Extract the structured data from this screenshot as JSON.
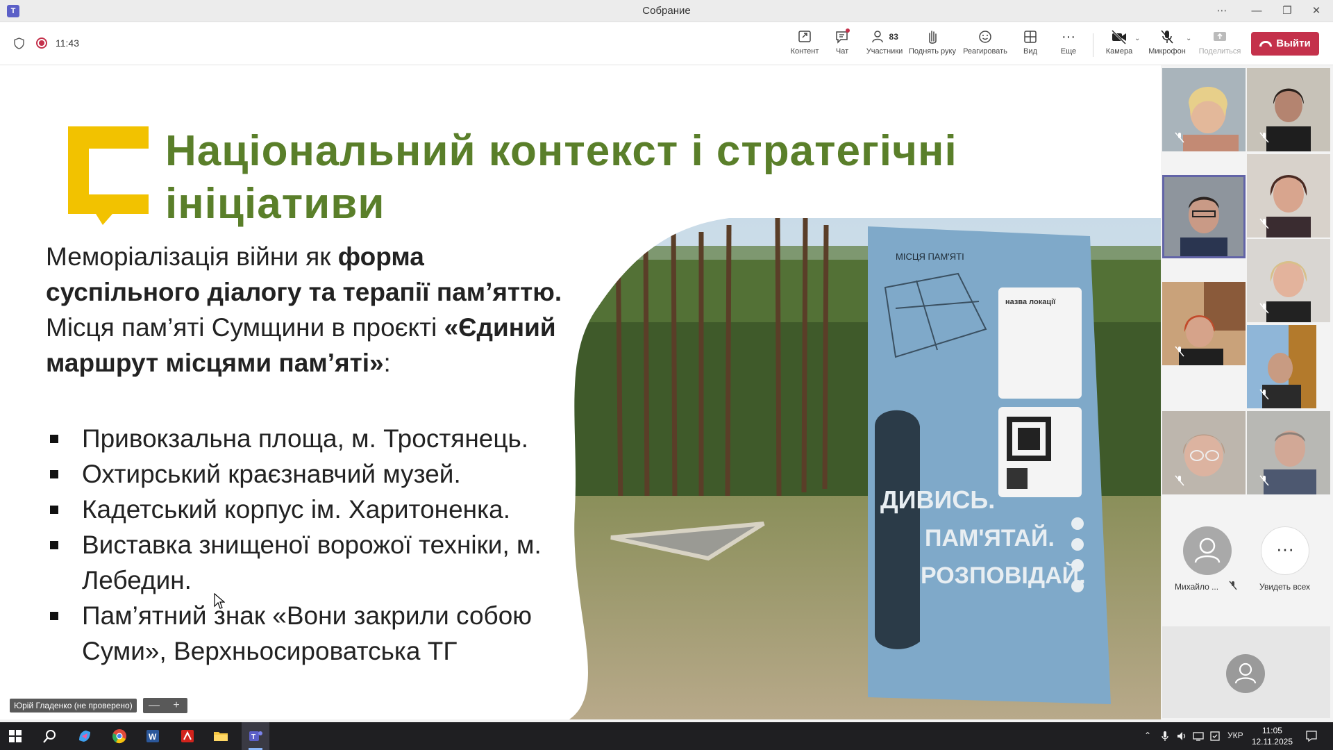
{
  "window": {
    "title": "Собрание"
  },
  "toolbar": {
    "timer": "11:43",
    "content": "Контент",
    "chat": "Чат",
    "participants_count": "83",
    "participants": "Участники",
    "raise_hand": "Поднять руку",
    "react": "Реагировать",
    "view": "Вид",
    "more": "Еще",
    "camera": "Камера",
    "microphone": "Микрофон",
    "share": "Поделиться",
    "leave": "Выйти"
  },
  "slide": {
    "title_line1": "Національний контекст і стратегічні",
    "title_line2": "ініціативи",
    "para1_normal": "Меморіалізація війни як ",
    "para1_bold": "форма суспільного діалогу та терапії пам’яттю.",
    "para2_normal": "Місця пам’яті Сумщини в проєкті ",
    "para2_bold": "«Єдиний маршрут місцями пам’яті»",
    "para2_end": ":",
    "bullets": [
      "Привокзальна площа, м. Тростянець.",
      "Охтирський краєзнавчий музей.",
      "Кадетський корпус ім. Харитоненка.",
      "Виставка знищеної ворожої техніки, м. Лебедин.",
      "Пам’ятний знак «Вони закрили собою Суми», Верхньосироватська ТГ"
    ],
    "sign_header": "МІСЦЯ ПАМ'ЯТІ",
    "sign_slogan_1": "ДИВИСЬ.",
    "sign_slogan_2": "ПАМ'ЯТАЙ.",
    "sign_slogan_3": "РОЗПОВІДАЙ.",
    "sign_box_title": "назва локації"
  },
  "presenter": {
    "name": "Юрій Гладенко (не проверено)",
    "zoom_out": "—",
    "zoom_in": "+"
  },
  "panel": {
    "avatar_name": "Михайло ...",
    "see_all": "Увидеть всех",
    "colors": {
      "tile_active": "#6264a7"
    }
  },
  "taskbar": {
    "lang": "УКР",
    "time": "11:05",
    "date": "12.11.2025"
  },
  "colors": {
    "title_green": "#5a7f2a",
    "logo_yellow": "#f2c200",
    "leave_red": "#c4314b",
    "sign_blue": "#7fa9c9"
  }
}
